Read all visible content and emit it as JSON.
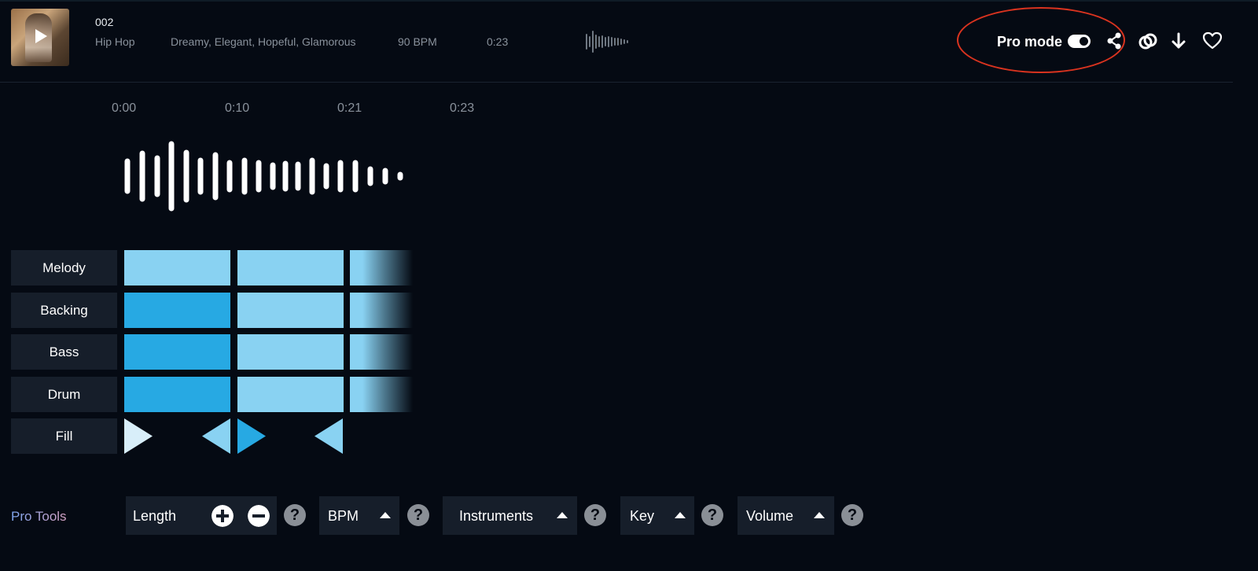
{
  "track": {
    "title": "002",
    "genre": "Hip Hop",
    "moods": "Dreamy, Elegant, Hopeful, Glamorous",
    "bpm": "90 BPM",
    "duration": "0:23"
  },
  "header": {
    "pro_mode_label": "Pro mode",
    "pro_mode_enabled": true,
    "icons": [
      "play-icon",
      "share-icon",
      "link-icon",
      "download-icon",
      "heart-icon"
    ],
    "highlight_color": "#d9331f"
  },
  "timeline": {
    "labels": [
      "0:00",
      "0:10",
      "0:21",
      "0:23"
    ]
  },
  "tracks": [
    {
      "label": "Melody",
      "blocks": [
        "light",
        "light",
        "light-fade"
      ]
    },
    {
      "label": "Backing",
      "blocks": [
        "dark",
        "light",
        "light-fade"
      ]
    },
    {
      "label": "Bass",
      "blocks": [
        "dark",
        "light",
        "light-fade"
      ]
    },
    {
      "label": "Drum",
      "blocks": [
        "dark",
        "light",
        "light-fade"
      ]
    },
    {
      "label": "Fill",
      "blocks": [
        "arrow-right-pale",
        "arrow-left",
        "arrow-right-blue",
        "arrow-left"
      ]
    }
  ],
  "colors": {
    "background": "#050a13",
    "block_light": "#89d2f2",
    "block_dark": "#27a9e3",
    "label_bg": "#161e2a"
  },
  "pro_tools": {
    "label": "Pro Tools",
    "length_label": "Length",
    "bpm_label": "BPM",
    "instruments_label": "Instruments",
    "key_label": "Key",
    "volume_label": "Volume",
    "help_glyph": "?"
  }
}
